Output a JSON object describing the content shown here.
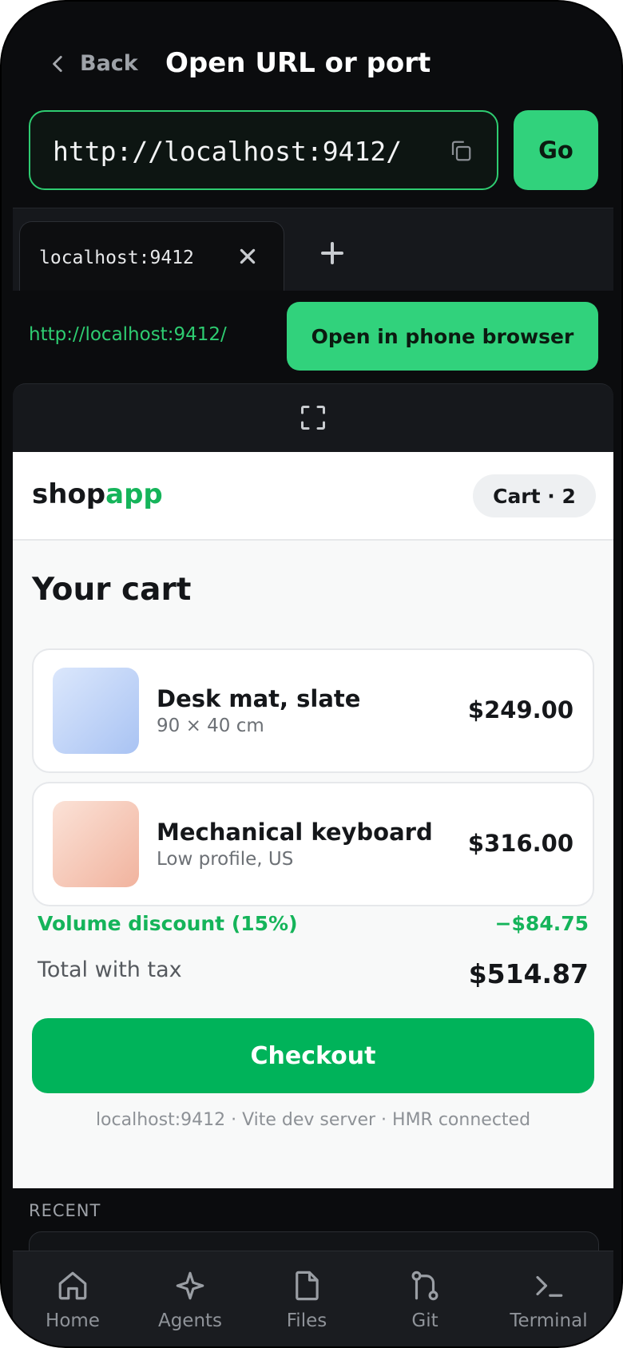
{
  "header": {
    "back_label": "Back",
    "title": "Open URL or port",
    "url_value": "http://localhost:9412/",
    "go_label": "Go"
  },
  "tabs": [
    {
      "label": "localhost:9412",
      "active": true
    }
  ],
  "open_row": {
    "url": "http://localhost:9412/",
    "button_label": "Open in phone browser"
  },
  "webview": {
    "brand_main": "shop",
    "brand_accent": "app",
    "cart_pill": "Cart · 2",
    "heading": "Your cart",
    "items": [
      {
        "name": "Desk mat, slate",
        "sub": "90 × 40 cm",
        "price": "$249.00"
      },
      {
        "name": "Mechanical keyboard",
        "sub": "Low profile, US",
        "price": "$316.00"
      }
    ],
    "discount_label": "Volume discount (15%)",
    "discount_value": "−$84.75",
    "total_label": "Total with tax",
    "total_value": "$514.87",
    "checkout_label": "Checkout",
    "footer": "localhost:9412 · Vite dev server · HMR connected"
  },
  "recent_label": "RECENT",
  "bottom_nav": [
    {
      "label": "Home",
      "icon": "home-icon"
    },
    {
      "label": "Agents",
      "icon": "sparkle-icon"
    },
    {
      "label": "Files",
      "icon": "file-icon"
    },
    {
      "label": "Git",
      "icon": "git-branch-icon"
    },
    {
      "label": "Terminal",
      "icon": "terminal-icon"
    }
  ],
  "colors": {
    "accent": "#31d27c",
    "shop_green": "#00b35a",
    "background": "#0b0c0e"
  }
}
